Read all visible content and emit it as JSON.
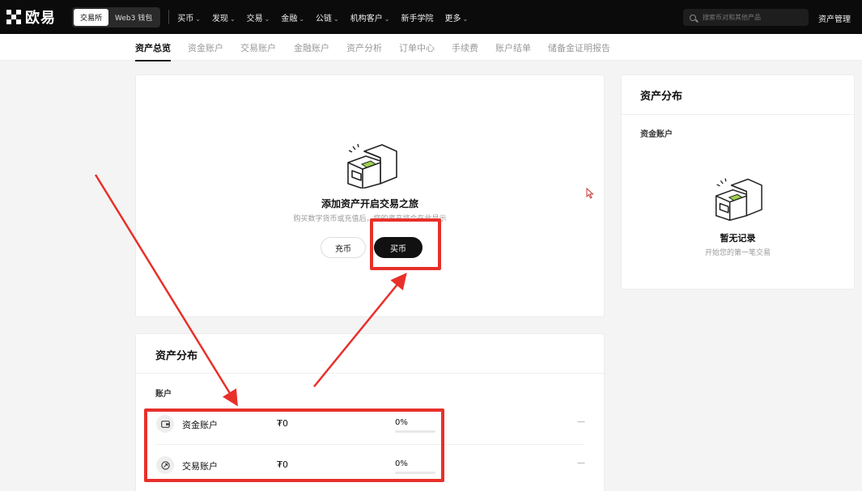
{
  "topnav": {
    "logo_text": "欧易",
    "segment": [
      "交易所",
      "Web3 钱包"
    ],
    "items": [
      "买币",
      "发现",
      "交易",
      "金融",
      "公链",
      "机构客户",
      "新手学院",
      "更多"
    ],
    "item_has_chevron": [
      true,
      true,
      true,
      true,
      true,
      true,
      false,
      true
    ],
    "search_placeholder": "搜索币对和其他产品",
    "asset_mgmt": "资产管理"
  },
  "subnav": {
    "tabs": [
      "资产总览",
      "资金账户",
      "交易账户",
      "金融账户",
      "资产分析",
      "订单中心",
      "手续费",
      "账户结单",
      "储备金证明报告"
    ],
    "active_index": 0
  },
  "empty_card": {
    "title": "添加资产开启交易之旅",
    "subtitle": "购买数字货币或充值后，您的资产将会在此显示",
    "deposit_label": "充币",
    "buy_label": "买币"
  },
  "right_card": {
    "title": "资产分布",
    "section": "资金账户",
    "empty_title": "暂无记录",
    "empty_sub": "开始您的第一笔交易"
  },
  "distribution": {
    "title": "资产分布",
    "column_header": "账户",
    "rows": [
      {
        "name": "资金账户",
        "amount": "₮0",
        "percent": "0%",
        "action": "—"
      },
      {
        "name": "交易账户",
        "amount": "₮0",
        "percent": "0%",
        "action": "—"
      }
    ]
  },
  "colors": {
    "annotation": "#e8302a",
    "nav_bg": "#0b0b0b",
    "accent_green": "#9bd34a"
  }
}
